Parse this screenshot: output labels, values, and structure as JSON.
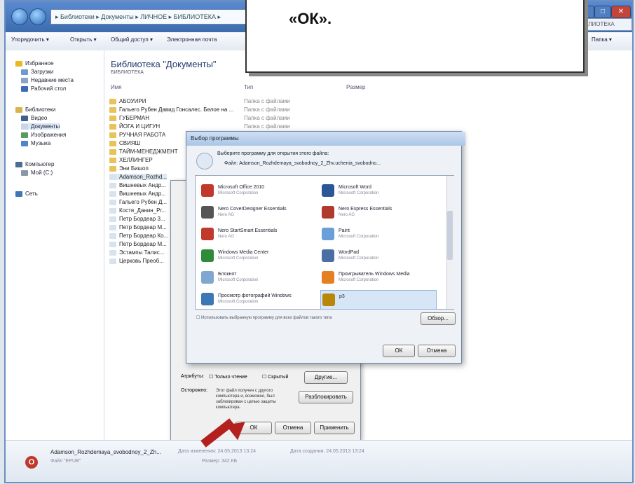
{
  "callout": {
    "text": "«ОК»."
  },
  "explorer": {
    "breadcrumb": "▸ Библиотеки ▸ Документы ▸ ЛИЧНОЕ ▸ БИБЛИОТЕКА ▸",
    "search_placeholder": "БИБЛИОТЕКА",
    "toolbar": [
      "Упорядочить ▾",
      "Открыть ▾",
      "Общий доступ ▾",
      "Электронная почта"
    ],
    "toolbar_right": "Папка ▾",
    "sidebar": [
      "Избранное",
      "Загрузки",
      "Недавние места",
      "Рабочий стол",
      "Библиотеки",
      "Видео",
      "Документы",
      "Изображения",
      "Музыка",
      "Компьютер",
      "Мой (C:)",
      "Сеть"
    ],
    "library_title": "Библиотека \"Документы\"",
    "library_sub": "БИБЛИОТЕКА",
    "col_name": "Имя",
    "col_type": "Тип",
    "col_size": "Размер",
    "files": [
      {
        "name": "АБОУИРИ",
        "type": "Папка с файлами"
      },
      {
        "name": "Гальего Рубен Давид Гонсалес. Белое на ...",
        "type": "Папка с файлами"
      },
      {
        "name": "ГУБЕРМАН",
        "type": "Папка с файлами"
      },
      {
        "name": "ЙОГА И ЦИГУН",
        "type": "Папка с файлами"
      },
      {
        "name": "РУЧНАЯ РАБОТА",
        "type": ""
      },
      {
        "name": "СВИЯШ",
        "type": ""
      },
      {
        "name": "ТАЙМ-МЕНЕДЖМЕНТ",
        "type": ""
      },
      {
        "name": "ХЕЛЛИНГЕР",
        "type": ""
      },
      {
        "name": "Эни Бишоп",
        "type": ""
      },
      {
        "name": "Adamson_Rozhd...",
        "type": ""
      },
      {
        "name": "Вишневых Андр...",
        "type": ""
      },
      {
        "name": "Вишневых Андр...",
        "type": ""
      },
      {
        "name": "Гальего Рубен Д...",
        "type": ""
      },
      {
        "name": "Костя_Данин_Рг...",
        "type": ""
      },
      {
        "name": "Петр Бордеар 3...",
        "type": ""
      },
      {
        "name": "Петр Бордеар М...",
        "type": ""
      },
      {
        "name": "Петр Бордеар Ко...",
        "type": ""
      },
      {
        "name": "Петр Бордеар М...",
        "type": ""
      },
      {
        "name": "Эстампы Талис...",
        "type": ""
      },
      {
        "name": "Церковь Преоб...",
        "type": ""
      }
    ],
    "status": {
      "filename": "Adamson_Rozhdemaya_svobodnoy_2_Zh...",
      "filetype": "Файл \"EPUB\"",
      "modified_label": "Дата изменения: 24.05.2013 13:24",
      "size_label": "Размер: 342 КБ",
      "created_label": "Дата создания: 24.05.2013 13:24"
    }
  },
  "props_dialog": {
    "attributes_label": "Атрибуты:",
    "readonly": "Только чтение",
    "hidden": "Скрытый",
    "other_button": "Другие...",
    "warning_label": "Осторожно:",
    "warning_text": "Этот файл получен с другого компьютера и, возможно, был заблокирован с целью защиты компьютера.",
    "unblock_button": "Разблокировать",
    "ok": "ОК",
    "cancel": "Отмена",
    "apply": "Применить"
  },
  "open_with": {
    "title": "Выбор программы",
    "instruction": "Выберите программу для открытия этого файла:",
    "file_line": "Файл:   Adamson_Rozhdemaya_svobodnoy_2_Zhv.uchenia_svobodno...",
    "programs": [
      {
        "name": "Microsoft Office 2010",
        "vendor": "Microsoft Corporation",
        "color": "#c0392b"
      },
      {
        "name": "Microsoft Word",
        "vendor": "Microsoft Corporation",
        "color": "#2b5797"
      },
      {
        "name": "Nero CoverDesigner Essentials",
        "vendor": "Nero AG",
        "color": "#555"
      },
      {
        "name": "Nero Express Essentials",
        "vendor": "Nero AG",
        "color": "#b03a2e"
      },
      {
        "name": "Nero StartSmart Essentials",
        "vendor": "Nero AG",
        "color": "#c0392b"
      },
      {
        "name": "Paint",
        "vendor": "Microsoft Corporation",
        "color": "#6a9fd8"
      },
      {
        "name": "Windows Media Center",
        "vendor": "Microsoft Corporation",
        "color": "#2e8b3a"
      },
      {
        "name": "WordPad",
        "vendor": "Microsoft Corporation",
        "color": "#4a6fa5"
      },
      {
        "name": "Блокнот",
        "vendor": "Microsoft Corporation",
        "color": "#7fa7cf"
      },
      {
        "name": "Проигрыватель Windows Media",
        "vendor": "Microsoft Corporation",
        "color": "#e67e22"
      },
      {
        "name": "Просмотр фотографий Windows",
        "vendor": "Microsoft Corporation",
        "color": "#3c78b5"
      },
      {
        "name": "p3",
        "vendor": "",
        "color": "#b8860b"
      }
    ],
    "always_use": "Использовать выбранную программу для всех файлов такого типа",
    "browse": "Обзор...",
    "ok": "ОК",
    "cancel": "Отмена"
  }
}
